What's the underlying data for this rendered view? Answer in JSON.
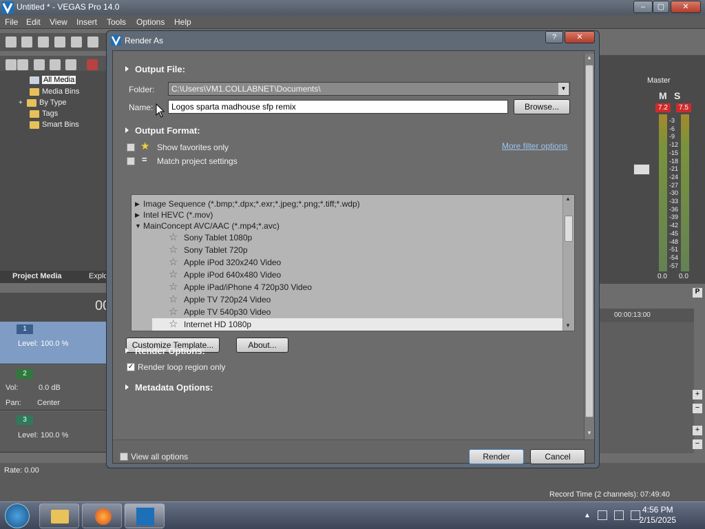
{
  "app": {
    "title": "Untitled * - VEGAS Pro 14.0",
    "menu": [
      "File",
      "Edit",
      "View",
      "Insert",
      "Tools",
      "Options",
      "Help"
    ],
    "window_buttons": [
      "–",
      "▢",
      "✕"
    ]
  },
  "project_media": {
    "tree": [
      "All Media",
      "Media Bins",
      "By Type",
      "Tags",
      "Smart Bins"
    ],
    "expander": "+",
    "tabs": [
      "Project Media",
      "Explo"
    ]
  },
  "timecode": "00",
  "tracks": [
    {
      "num": "1",
      "level_label": "Level:",
      "level_value": "100.0 %"
    },
    {
      "num": "2",
      "vol_label": "Vol:",
      "vol_value": "0.0 dB",
      "pan_label": "Pan:",
      "pan_value": "Center"
    },
    {
      "num": "3",
      "level_label": "Level:",
      "level_value": "100.0 %"
    }
  ],
  "status": {
    "rate": "Rate: 0.00",
    "record_time": "Record Time (2 channels): 07:49:40"
  },
  "mixer": {
    "master_label": "Master",
    "m_label": "M",
    "s_label": "S",
    "peak_left": "7.2",
    "peak_right": "7.5",
    "db_scale": [
      "3",
      "6",
      "9",
      "12",
      "15",
      "18",
      "21",
      "24",
      "27",
      "30",
      "33",
      "36",
      "39",
      "42",
      "45",
      "48",
      "51",
      "54",
      "57"
    ],
    "meter_left": "0.0",
    "meter_right": "0.0"
  },
  "timeline": {
    "ruler_time": "00:00:13:00",
    "buttons": [
      "P",
      "+",
      "−",
      "+",
      "−"
    ]
  },
  "dialog": {
    "title": "Render As",
    "help": "?",
    "close": "✕",
    "output_file": {
      "heading": "Output File:",
      "folder_label": "Folder:",
      "folder_value": "C:\\Users\\VM1.COLLABNET\\Documents\\",
      "name_label": "Name:",
      "name_value": "Logos sparta madhouse sfp remix",
      "browse": "Browse..."
    },
    "output_format": {
      "heading": "Output Format:",
      "show_favorites": "Show favorites only",
      "match_settings": "Match project settings",
      "more_filter": "More filter options",
      "formats": [
        {
          "label": "Image Sequence (*.bmp;*.dpx;*.exr;*.jpeg;*.png;*.tiff;*.wdp)",
          "type": "collapsed"
        },
        {
          "label": "Intel HEVC (*.mov)",
          "type": "collapsed"
        },
        {
          "label": "MainConcept AVC/AAC (*.mp4;*.avc)",
          "type": "expanded"
        }
      ],
      "templates": [
        "Sony Tablet 1080p",
        "Sony Tablet 720p",
        "Apple iPod 320x240 Video",
        "Apple iPod 640x480 Video",
        "Apple iPad/iPhone 4 720p30 Video",
        "Apple TV 720p24 Video",
        "Apple TV 540p30 Video",
        "Internet HD 1080p"
      ],
      "selected_template": "Internet HD 1080p",
      "customize": "Customize Template...",
      "about": "About..."
    },
    "render_options": {
      "heading": "Render Options:",
      "loop_region": "Render loop region only",
      "loop_checked": true
    },
    "metadata": {
      "heading": "Metadata Options:"
    },
    "view_all": "View all options",
    "render_btn": "Render",
    "cancel_btn": "Cancel"
  },
  "taskbar": {
    "time": "4:56 PM",
    "date": "2/15/2025"
  }
}
